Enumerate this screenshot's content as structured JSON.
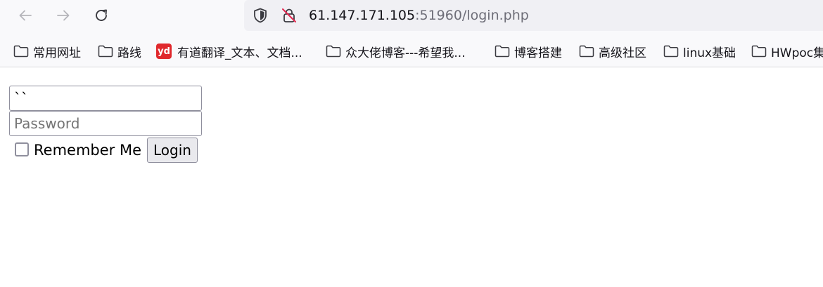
{
  "browser": {
    "url_host": "61.147.171.105",
    "url_rest": ":51960/login.php",
    "icons": {
      "back": "arrow-left-icon",
      "forward": "arrow-right-icon",
      "reload": "reload-icon",
      "tracking_protection": "shield-icon",
      "connection": "insecure-lock-icon"
    }
  },
  "bookmarks": {
    "items": [
      {
        "label": "常用网址",
        "icon": "folder-icon"
      },
      {
        "label": "路线",
        "icon": "folder-icon"
      },
      {
        "label": "有道翻译_文本、文档...",
        "icon": "youdao-icon",
        "icon_text": "yd",
        "icon_color": "#e0282c"
      },
      {
        "label": "众大佬博客---希望我...",
        "icon": "folder-icon"
      },
      {
        "label": "博客搭建",
        "icon": "folder-icon"
      },
      {
        "label": "高级社区",
        "icon": "folder-icon"
      },
      {
        "label": "linux基础",
        "icon": "folder-icon"
      },
      {
        "label": "HWpoc集",
        "icon": "folder-icon"
      }
    ]
  },
  "login": {
    "username_value": "``",
    "password_placeholder": "Password",
    "remember_label": "Remember Me",
    "remember_checked": false,
    "login_label": "Login"
  }
}
